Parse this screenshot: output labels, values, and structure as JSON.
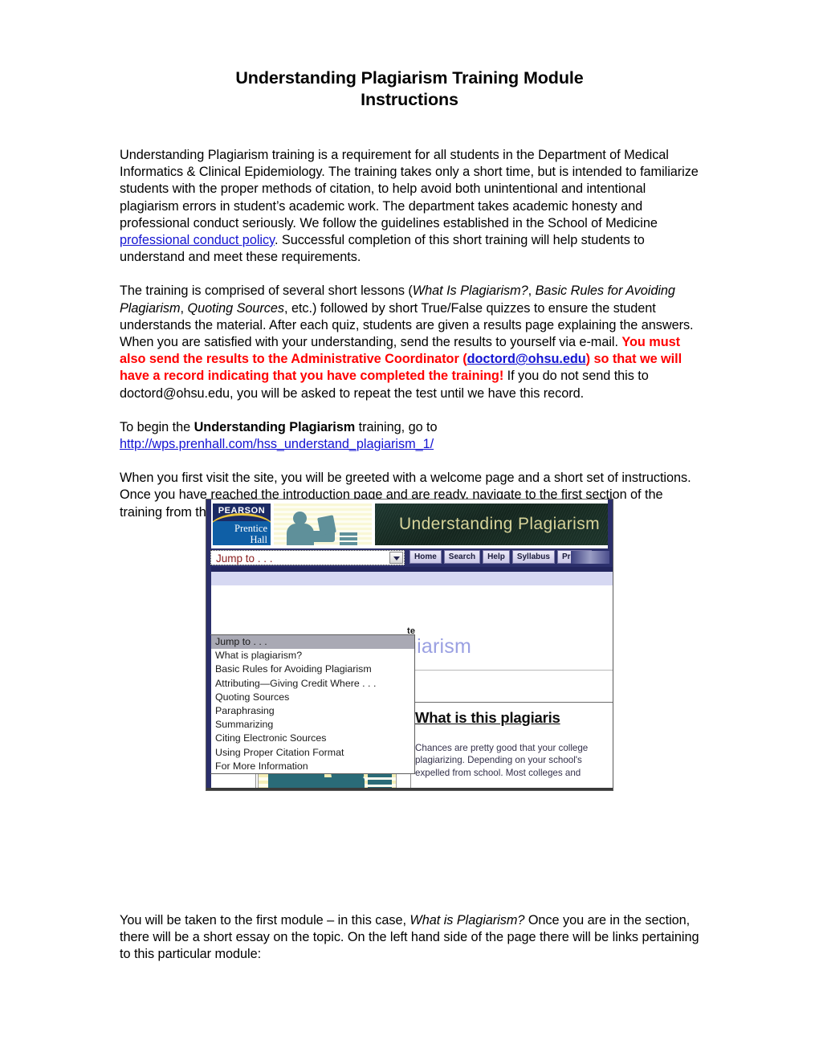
{
  "document": {
    "title_line_1": "Understanding Plagiarism Training Module",
    "title_line_2": "Instructions",
    "paragraph_1": {
      "text_before_link": "Understanding Plagiarism training is a requirement for all students in the Department of Medical Informatics & Clinical Epidemiology.  The training takes only a short time, but is intended to familiarize students with the proper methods of citation, to help avoid both unintentional and intentional plagiarism errors in student’s academic work.  The department takes academic honesty and professional conduct seriously.  We follow the guidelines established in the School of Medicine ",
      "link_text": "professional conduct policy",
      "text_after_link": ". Successful completion of this short training will help students to understand and meet these requirements."
    },
    "paragraph_2": {
      "seg_1": "The training is comprised of several short lessons (",
      "italic_1": "What Is Plagiarism?",
      "seg_2": ", ",
      "italic_2": "Basic Rules for Avoiding Plagiarism",
      "seg_3": ", ",
      "italic_3": "Quoting Sources",
      "seg_4": ", etc.) followed by short True/False quizzes to ensure the student understands the material.  After each quiz, students are given a results page explaining the answers.  When you are satisfied with your understanding, send the results to yourself via e-mail. ",
      "red_1": "You must also send the results to the Administrative Coordinator (",
      "red_link": "doctord@ohsu.edu",
      "red_2": ") so that we will have a record indicating that you have completed the training!",
      "seg_5": "  If you do not send this to doctord@ohsu.edu, you will be asked to repeat the test until we have this record."
    },
    "paragraph_3": {
      "seg_1": "To begin the ",
      "bold_1": "Understanding Plagiarism",
      "seg_2": " training, go to ",
      "url": "http://wps.prenhall.com/hss_understand_plagiarism_1/"
    },
    "paragraph_4": "When you first visit the site, you will be greeted with a welcome page and a short set of instructions.  Once you have reached the introduction page and are ready, navigate to the first section of the training from the drop down menu provided:",
    "paragraph_5": {
      "seg_1": "You will be taken to the first module – in this case, ",
      "italic_1": "What is Plagiarism?",
      "seg_2": " Once you are in the section, there will be a short essay on the topic.  On the left hand side of the page there will be links pertaining to this particular module:"
    }
  },
  "screenshot": {
    "logo": {
      "brand": "PEARSON",
      "imprint_line_1": "Prentice",
      "imprint_line_2": "Hall"
    },
    "banner_title": "Understanding Plagiarism",
    "select": {
      "value": "Jump to . . .",
      "options": [
        "Jump to . . .",
        "What is plagiarism?",
        "Basic Rules for Avoiding Plagiarism",
        "Attributing—Giving Credit Where . . .",
        "Quoting Sources",
        "Paraphrasing",
        "Summarizing",
        "Citing Electronic Sources",
        "Using Proper Citation Format",
        "For More Information"
      ]
    },
    "nav_buttons": [
      "Home",
      "Search",
      "Help",
      "Syllabus",
      "Profile"
    ],
    "obscured_bold_fragment": "te",
    "obscured_title_fragment": "giarism",
    "content_heading": "What is this plagiaris",
    "content_body_lines": [
      "Chances are pretty good that your college",
      "plagiarizing. Depending on your school's ",
      "expelled from school. Most colleges and "
    ]
  },
  "colors": {
    "link": "#1414d2",
    "alert_red": "#ff0000",
    "pearson_navy": "#1b2a63",
    "pearson_blue": "#0f5fa6",
    "banner_green": "#1f3a32",
    "banner_text": "#d8d49a",
    "toolbar_navy": "#2b2f6b",
    "lavender_band": "#d6d8f2",
    "silhouette_teal": "#2a6b78"
  }
}
